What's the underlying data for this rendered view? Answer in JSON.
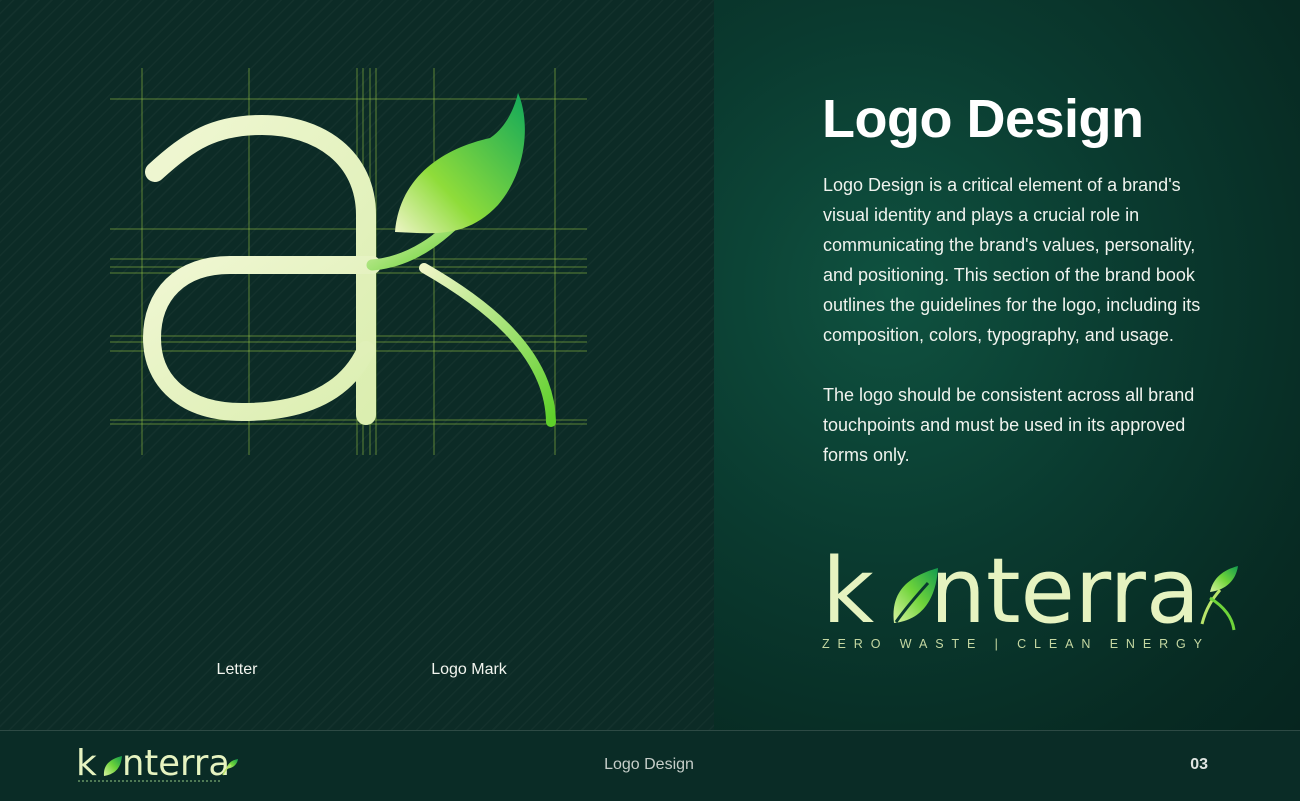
{
  "main": {
    "heading": "Logo Design",
    "paragraph_1": "Logo Design is a critical element of a brand's visual identity and plays a crucial role in communicating the brand's values, personality, and positioning. This section of the brand book outlines the guidelines for the logo, including its composition, colors, typography, and usage.",
    "paragraph_2": "The logo should be consistent across all brand touchpoints and must be used in its approved forms only."
  },
  "construction": {
    "caption_left": "Letter",
    "caption_right": "Logo Mark"
  },
  "logo": {
    "wordmark_start": "k",
    "wordmark_end": "nterra",
    "tagline": "ZERO WASTE | CLEAN ENERGY",
    "icon": "leaf-icon"
  },
  "footer": {
    "section_title": "Logo Design",
    "page_number": "03"
  },
  "colors": {
    "background_dark": "#0c2b26",
    "panel_green": "#0f5240",
    "letter_cream": "#e8f3c4",
    "leaf_green": "#2bb24a",
    "leaf_lime": "#8ee03a",
    "grid_line": "#9ccc45"
  }
}
